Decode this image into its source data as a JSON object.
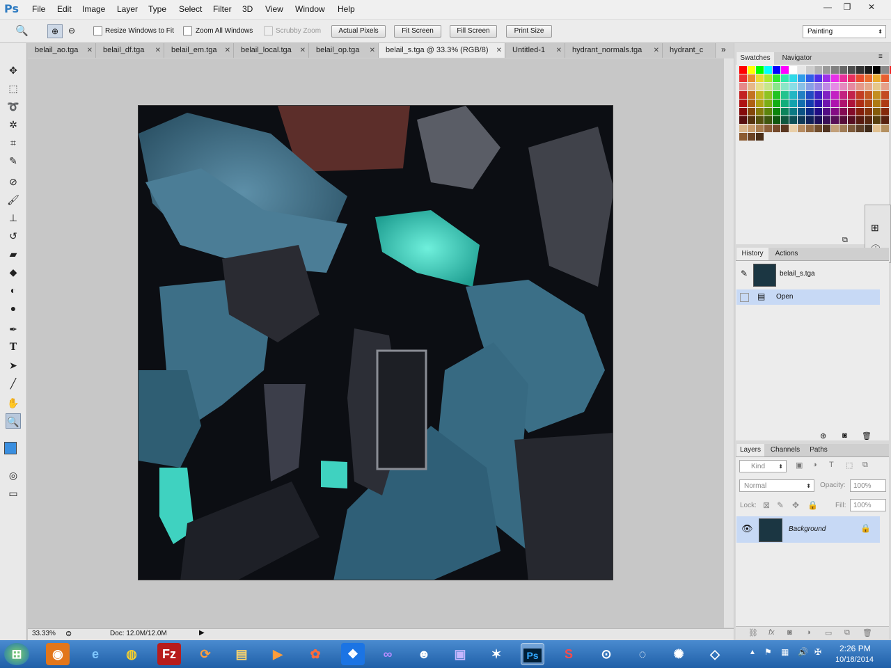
{
  "app": {
    "logo": "Ps"
  },
  "menu": [
    "File",
    "Edit",
    "Image",
    "Layer",
    "Type",
    "Select",
    "Filter",
    "3D",
    "View",
    "Window",
    "Help"
  ],
  "window_controls": {
    "minimize": "—",
    "restore": "❐",
    "close": "✕"
  },
  "options": {
    "resize_windows": "Resize Windows to Fit",
    "zoom_all": "Zoom All Windows",
    "scrubby_zoom": "Scrubby Zoom",
    "actual_pixels": "Actual Pixels",
    "fit_screen": "Fit Screen",
    "fill_screen": "Fill Screen",
    "print_size": "Print Size",
    "workspace": "Painting"
  },
  "tabs": [
    {
      "label": "belail_ao.tga"
    },
    {
      "label": "belail_df.tga"
    },
    {
      "label": "belail_em.tga"
    },
    {
      "label": "belail_local.tga"
    },
    {
      "label": "belail_op.tga"
    },
    {
      "label": "belail_s.tga @ 33.3% (RGB/8)"
    },
    {
      "label": "Untitled-1"
    },
    {
      "label": "hydrant_normals.tga"
    },
    {
      "label": "hydrant_c"
    }
  ],
  "tab_overflow": "»",
  "status": {
    "zoom": "33.33%",
    "doc": "Doc: 12.0M/12.0M"
  },
  "panels": {
    "swatches_tab": "Swatches",
    "navigator_tab": "Navigator",
    "history_tab": "History",
    "actions_tab": "Actions",
    "history_snapshot": "belail_s.tga",
    "history_step": "Open",
    "layers_tab": "Layers",
    "channels_tab": "Channels",
    "paths_tab": "Paths",
    "kind": "Kind",
    "blend_mode": "Normal",
    "opacity_label": "Opacity:",
    "opacity": "100%",
    "lock_label": "Lock:",
    "fill_label": "Fill:",
    "fill": "100%",
    "layer_name": "Background"
  },
  "clock": {
    "time": "2:26 PM",
    "date": "10/18/2014"
  },
  "colors": {
    "foreground": "#3a8fe0",
    "background": "#000000"
  }
}
